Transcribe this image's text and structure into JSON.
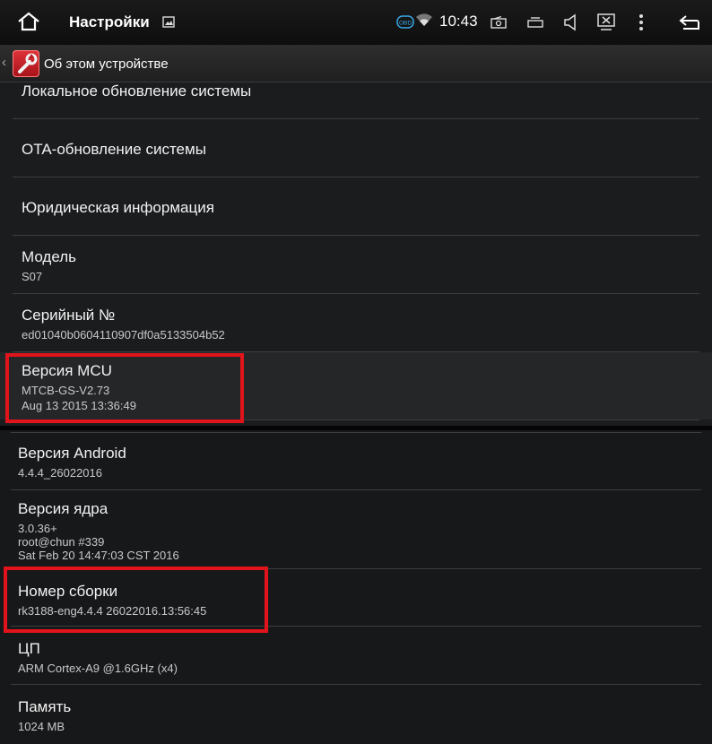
{
  "status_bar": {
    "title": "Настройки",
    "obd_label": "OBD",
    "time": "10:43",
    "icons": [
      "home-icon",
      "image-icon",
      "obd-icon",
      "wifi-icon",
      "radio-icon",
      "window-icon",
      "volume-icon",
      "screen-off-icon",
      "overflow-menu-icon",
      "back-arrow-icon"
    ]
  },
  "action_bar": {
    "back_glyph": "‹",
    "title": "Об этом устройстве"
  },
  "settings_top": {
    "local_update": "Локальное обновление системы",
    "ota_update": "OTA-обновление системы",
    "legal_info": "Юридическая информация",
    "model_label": "Модель",
    "model_value": "S07",
    "serial_label": "Серийный №",
    "serial_value": "ed01040b0604110907df0a5133504b52",
    "mcu_label": "Версия MCU",
    "mcu_value": "MTCB-GS-V2.73",
    "mcu_date": "Aug 13 2015  13:36:49"
  },
  "settings_bottom": {
    "android_label": "Версия Android",
    "android_value": "4.4.4_26022016",
    "kernel_label": "Версия ядра",
    "kernel_value_1": "3.0.36+",
    "kernel_value_2": "root@chun #339",
    "kernel_value_3": "Sat Feb 20 14:47:03 CST 2016",
    "build_label": "Номер сборки",
    "build_value": "rk3188-eng4.4.4 26022016.13:56:45",
    "cpu_label": "ЦП",
    "cpu_value": "ARM Cortex-A9 @1.6GHz (x4)",
    "memory_label": "Память",
    "memory_value": "1024 MB"
  },
  "colors": {
    "highlight": "#e1141b",
    "panel_bg": "#1b1c1e",
    "divider": "#3b3d40"
  }
}
